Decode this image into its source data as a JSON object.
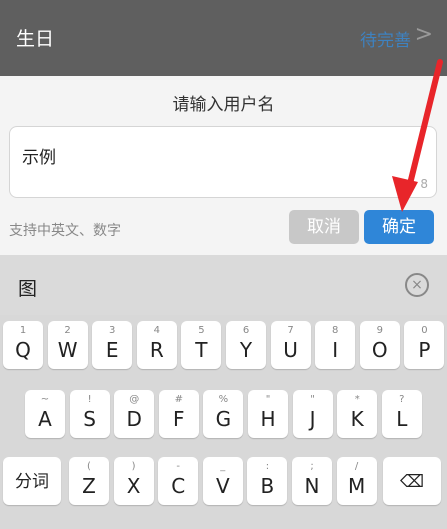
{
  "settings_row": {
    "label": "生日",
    "value": "待完善",
    "chevron": ">"
  },
  "dialog": {
    "title": "请输入用户名",
    "input_value": "示例",
    "counter": "8",
    "hint": "支持中英文、数字",
    "cancel_label": "取消",
    "ok_label": "确定"
  },
  "keyboard": {
    "candidate": "图",
    "clear_icon": "×",
    "row1": [
      {
        "key": "Q",
        "sub": "1"
      },
      {
        "key": "W",
        "sub": "2"
      },
      {
        "key": "E",
        "sub": "3"
      },
      {
        "key": "R",
        "sub": "4"
      },
      {
        "key": "T",
        "sub": "5"
      },
      {
        "key": "Y",
        "sub": "6"
      },
      {
        "key": "U",
        "sub": "7"
      },
      {
        "key": "I",
        "sub": "8"
      },
      {
        "key": "O",
        "sub": "9"
      },
      {
        "key": "P",
        "sub": "0"
      }
    ],
    "row2": [
      {
        "key": "A",
        "sub": "~"
      },
      {
        "key": "S",
        "sub": "!"
      },
      {
        "key": "D",
        "sub": "@"
      },
      {
        "key": "F",
        "sub": "#"
      },
      {
        "key": "G",
        "sub": "%"
      },
      {
        "key": "H",
        "sub": "\""
      },
      {
        "key": "J",
        "sub": "\""
      },
      {
        "key": "K",
        "sub": "*"
      },
      {
        "key": "L",
        "sub": "?"
      }
    ],
    "row3": [
      {
        "key": "Z",
        "sub": "("
      },
      {
        "key": "X",
        "sub": ")"
      },
      {
        "key": "C",
        "sub": "-"
      },
      {
        "key": "V",
        "sub": "_"
      },
      {
        "key": "B",
        "sub": ":"
      },
      {
        "key": "N",
        "sub": ";"
      },
      {
        "key": "M",
        "sub": "/"
      }
    ],
    "fenci_label": "分词",
    "backspace_icon": "⌫"
  },
  "colors": {
    "accent": "#2f86d8",
    "arrow": "#e8252a"
  }
}
